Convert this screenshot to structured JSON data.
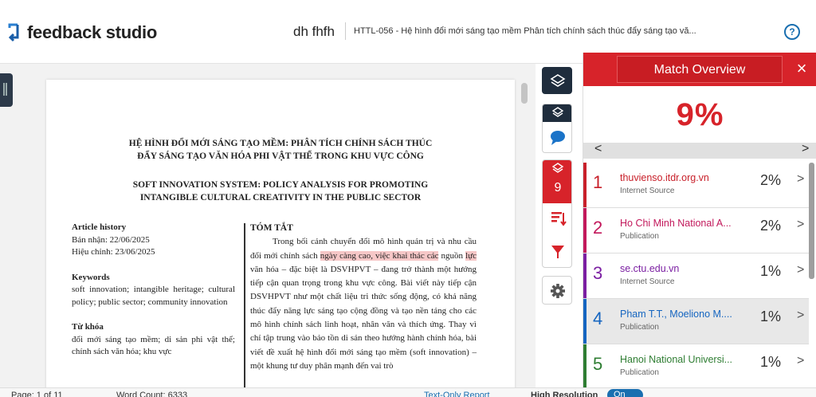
{
  "app": {
    "name": "feedback studio"
  },
  "header": {
    "author": "dh fhfh",
    "title": "HTTL-056 - Hệ hình đổi mới sáng tạo mềm Phân tích chính sách thúc đẩy sáng tạo vă..."
  },
  "document": {
    "title_vi_line1": "HỆ HÌNH ĐỔI MỚI SÁNG TẠO MỀM: PHÂN TÍCH CHÍNH SÁCH THÚC",
    "title_vi_line2": "ĐẨY SÁNG TẠO VĂN HÓA PHI VẬT THỂ TRONG KHU VỰC CÔNG",
    "title_en_line1": "SOFT INNOVATION SYSTEM: POLICY ANALYSIS FOR PROMOTING",
    "title_en_line2": "INTANGIBLE CULTURAL CREATIVITY IN THE PUBLIC SECTOR",
    "left": {
      "article_history_label": "Article history",
      "received": "Bản nhận: 22/06/2025",
      "revised": "Hiệu chỉnh: 23/06/2025",
      "keywords_label": "Keywords",
      "keywords_text": "soft innovation; intangible heritage; cultural policy; public sector; community innovation",
      "tukhoa_label": "Từ khóa",
      "tukhoa_text": "đổi mới sáng tạo mềm; di sản phi vật thể; chính sách văn hóa; khu vực"
    },
    "abstract": {
      "heading": "TÓM TẮT",
      "p1": "Trong bối cảnh chuyển đổi mô hình quản trị và nhu cầu đổi mới chính sách ",
      "hl1": "ngày càng cao, việc khai thác các",
      "p2": " nguồn ",
      "hl2": "lực",
      "p3": " văn hóa – đặc biệt là DSVHPVT – đang trở thành một hướng tiếp cận quan trọng trong khu vực công. Bài viết này tiếp cận DSVHPVT như một chất liệu tri thức sống động, có khả năng thúc đẩy năng lực sáng tạo cộng đồng và tạo nền tảng cho các mô hình chính sách linh hoạt, nhân văn và thích ứng. Thay vì chỉ tập trung vào bảo tồn di sản theo hướng hành chính hóa, bài viết đề xuất hệ hình đổi mới sáng tạo mềm (soft innovation) – một khung tư duy phân mạnh đến vai trò"
    }
  },
  "toolbar": {
    "layers_badge_count": "9"
  },
  "panel": {
    "title": "Match Overview",
    "close": "×",
    "percent": "9%",
    "prev": "<",
    "next": ">",
    "matches": [
      {
        "num": "1",
        "source": "thuvienso.itdr.org.vn",
        "type": "Internet Source",
        "pct": "2%",
        "color": "#c8202a"
      },
      {
        "num": "2",
        "source": "Ho Chi Minh National A...",
        "type": "Publication",
        "pct": "2%",
        "color": "#c2185b"
      },
      {
        "num": "3",
        "source": "se.ctu.edu.vn",
        "type": "Internet Source",
        "pct": "1%",
        "color": "#7b1fa2"
      },
      {
        "num": "4",
        "source": "Pham T.T., Moeliono M....",
        "type": "Publication",
        "pct": "1%",
        "color": "#1565c0"
      },
      {
        "num": "5",
        "source": "Hanoi National Universi...",
        "type": "Publication",
        "pct": "1%",
        "color": "#2e7d32"
      }
    ]
  },
  "status": {
    "page": "Page: 1 of 11",
    "word_count": "Word Count: 6333",
    "text_only": "Text-Only Report",
    "high_res": "High Resolution",
    "toggle": "On"
  }
}
